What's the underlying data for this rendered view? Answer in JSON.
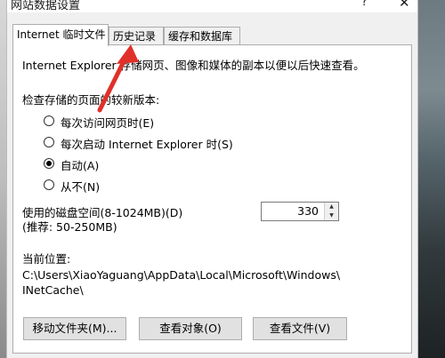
{
  "window": {
    "title": "网站数据设置",
    "help": "?",
    "close": "✕"
  },
  "tabs": [
    {
      "label": "Internet 临时文件",
      "active": true
    },
    {
      "label": "历史记录",
      "active": false
    },
    {
      "label": "缓存和数据库",
      "active": false
    }
  ],
  "panel": {
    "description": "Internet Explorer 存储网页、图像和媒体的副本以便以后快速查看。",
    "check_label": "检查存储的页面的较新版本:",
    "options": [
      {
        "label": "每次访问网页时(E)",
        "selected": false
      },
      {
        "label": "每次启动 Internet Explorer 时(S)",
        "selected": false
      },
      {
        "label": "自动(A)",
        "selected": true
      },
      {
        "label": "从不(N)",
        "selected": false
      }
    ],
    "disk_space_label": "使用的磁盘空间(8-1024MB)(D)",
    "disk_space_recommend": "(推荐: 50-250MB)",
    "disk_space_value": "330",
    "location_label": "当前位置:",
    "location_line1": "C:\\Users\\XiaoYaguang\\AppData\\Local\\Microsoft\\Windows\\",
    "location_line2": "INetCache\\",
    "buttons": {
      "move_folder": "移动文件夹(M)...",
      "view_objects": "查看对象(O)",
      "view_files": "查看文件(V)"
    }
  },
  "colors": {
    "dialog_bg": "#f0f0f0",
    "panel_bg": "#ffffff",
    "annotation_arrow": "#e0302a"
  }
}
